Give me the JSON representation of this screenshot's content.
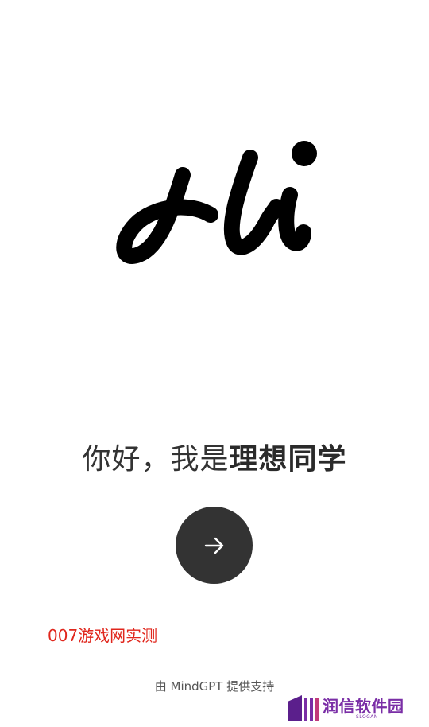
{
  "logo": {
    "icon": "hi-script-logo"
  },
  "greeting": {
    "prefix": "你好，我是",
    "name": "理想同学"
  },
  "start_button": {
    "icon": "arrow-right-icon"
  },
  "watermark": {
    "text": "007游戏网实测"
  },
  "footer": {
    "powered_by": "由 MindGPT 提供支持"
  },
  "site_badge": {
    "brand": "润信软件园",
    "slogan": "SLOGAN",
    "icon": "building-logo-icon"
  },
  "colors": {
    "background": "#ffffff",
    "button": "#333333",
    "watermark": "#e0261c",
    "badge": "#7a2ea6"
  }
}
